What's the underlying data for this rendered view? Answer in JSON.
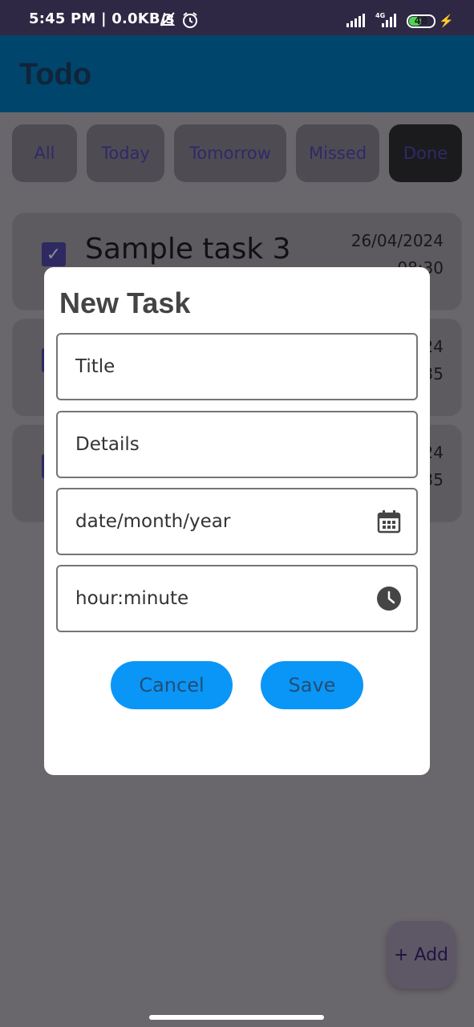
{
  "status_bar": {
    "time": "5:45 PM | 0.0KB/s",
    "network": "4G",
    "battery": "48",
    "icons": [
      "mute-icon",
      "alarm-icon",
      "signal-icon",
      "4g-signal-icon",
      "battery-icon",
      "charging-icon"
    ]
  },
  "app_bar": {
    "title": "Todo"
  },
  "filters": [
    {
      "label": "All"
    },
    {
      "label": "Today"
    },
    {
      "label": "Tomorrow"
    },
    {
      "label": "Missed"
    },
    {
      "label": "Done",
      "selected": true
    }
  ],
  "tasks": [
    {
      "title": "Sample task 3",
      "date": "26/04/2024",
      "time": "08:30",
      "checked": true
    },
    {
      "title": "",
      "date": "24",
      "time": "35",
      "checked": true
    },
    {
      "title": "",
      "date": "24",
      "time": "35",
      "checked": true
    }
  ],
  "dialog": {
    "title": "New Task",
    "title_placeholder": "Title",
    "details_placeholder": "Details",
    "date_placeholder": "date/month/year",
    "time_placeholder": "hour:minute",
    "date_icon": "calendar-icon",
    "time_icon": "clock-icon",
    "cancel_label": "Cancel",
    "save_label": "Save"
  },
  "fab": {
    "label": "+ Add"
  },
  "colors": {
    "accent": "#0a96f7",
    "app_bar": "#00456b",
    "scrim": "#69676c",
    "check": "#2e2960"
  }
}
